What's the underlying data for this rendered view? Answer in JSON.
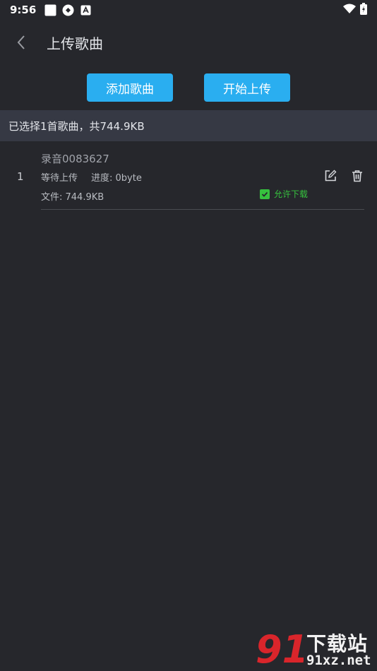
{
  "status_bar": {
    "time": "9:56"
  },
  "app_bar": {
    "title": "上传歌曲"
  },
  "actions": {
    "add_label": "添加歌曲",
    "start_label": "开始上传"
  },
  "summary": {
    "text": "已选择1首歌曲，共744.9KB"
  },
  "songs": [
    {
      "index": "1",
      "name": "录音0083627",
      "status": "等待上传",
      "progress": "进度: 0byte",
      "file": "文件: 744.9KB",
      "allow_download_label": "允许下载",
      "allow_download": true
    }
  ],
  "watermark": {
    "logo_text": "91",
    "cn": "下载站",
    "en": "91xz.net"
  },
  "colors": {
    "background": "#26272c",
    "accent": "#2aaef0",
    "summary_bar": "#363944",
    "check_green": "#36c23e"
  }
}
